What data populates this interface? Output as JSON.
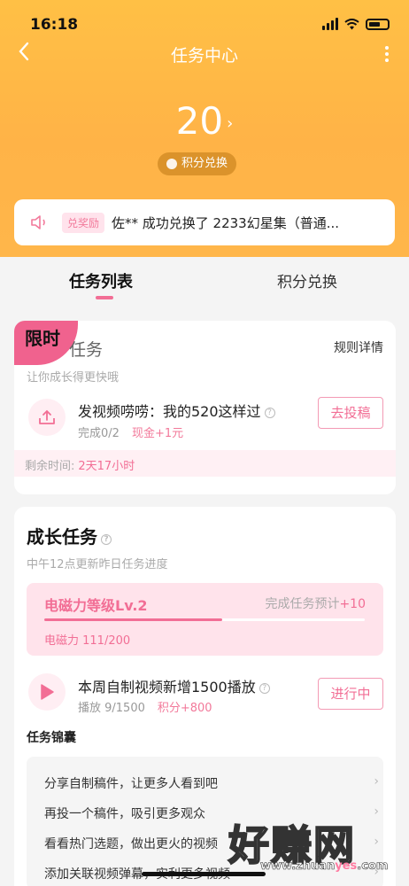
{
  "status_bar": {
    "time": "16:18"
  },
  "nav": {
    "title": "任务中心",
    "back_icon": "chevron-left-icon",
    "more_icon": "more-vertical-icon"
  },
  "points": {
    "value": "20",
    "arrow": "›",
    "redeem_label": "积分兑换"
  },
  "ticker": {
    "tag": "兑奖励",
    "text": "佐** 成功兑换了 2233幻星集（普通..."
  },
  "tabs": {
    "active": "任务列表",
    "inactive": "积分兑换"
  },
  "limited_card": {
    "badge": "限时",
    "title": "任务",
    "rules": "规则详情",
    "subtitle": "让你成长得更快哦",
    "task": {
      "title": "发视频唠唠：我的520这样过",
      "progress": "完成0/2",
      "reward": "现金+1元",
      "button": "去投稿"
    },
    "deadline_label": "剩余时间:",
    "deadline_value": "2天17小时"
  },
  "growth_card": {
    "title": "成长任务",
    "subtitle": "中午12点更新昨日任务进度",
    "level": {
      "title": "电磁力等级Lv.2",
      "right_label": "完成任务预计",
      "right_value": "+10",
      "value_text": "电磁力 111/200",
      "progress": 0.555
    },
    "task": {
      "title": "本周自制视频新增1500播放",
      "progress": "播放 9/1500",
      "reward": "积分+800",
      "button": "进行中"
    },
    "kit_title": "任务锦囊",
    "kit_items": [
      {
        "label": "分享自制稿件，让更多人看到吧"
      },
      {
        "label": "再投一个稿件，吸引更多观众"
      },
      {
        "label": "看看热门选题，做出更火的视频"
      },
      {
        "label": "添加关联视频弹幕，实利更多视频"
      }
    ]
  },
  "watermark": {
    "big": "好赚网",
    "small_a": "www.zhuan",
    "small_b": "yes",
    "small_c": ".com"
  },
  "colors": {
    "hero": "#ffb347",
    "accent": "#f26e95",
    "badge": "#f0628e"
  }
}
